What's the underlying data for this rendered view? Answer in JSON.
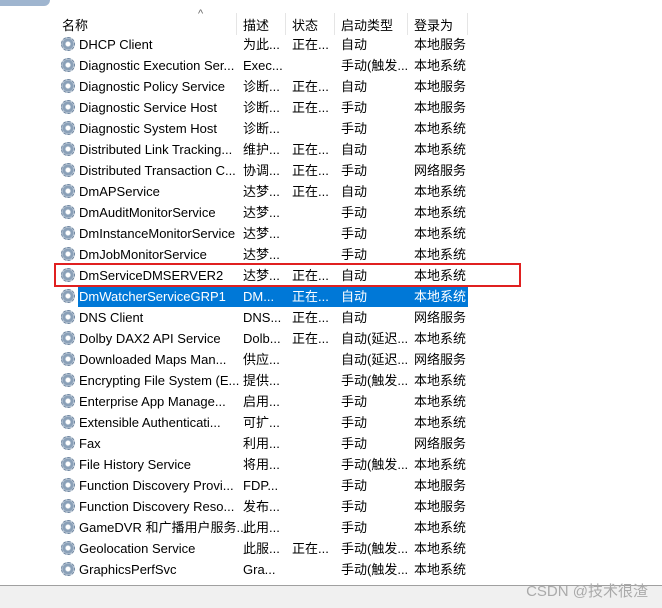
{
  "columns": [
    "名称",
    "描述",
    "状态",
    "启动类型",
    "登录为"
  ],
  "sort_indicator": "^",
  "selected_index": 12,
  "highlighted_index": 11,
  "rows": [
    {
      "name": "DHCP Client",
      "desc": "为此...",
      "status": "正在...",
      "startup": "自动",
      "logon": "本地服务"
    },
    {
      "name": "Diagnostic Execution Ser...",
      "desc": "Exec...",
      "status": "",
      "startup": "手动(触发...",
      "logon": "本地系统"
    },
    {
      "name": "Diagnostic Policy Service",
      "desc": "诊断...",
      "status": "正在...",
      "startup": "自动",
      "logon": "本地服务"
    },
    {
      "name": "Diagnostic Service Host",
      "desc": "诊断...",
      "status": "正在...",
      "startup": "手动",
      "logon": "本地服务"
    },
    {
      "name": "Diagnostic System Host",
      "desc": "诊断...",
      "status": "",
      "startup": "手动",
      "logon": "本地系统"
    },
    {
      "name": "Distributed Link Tracking...",
      "desc": "维护...",
      "status": "正在...",
      "startup": "自动",
      "logon": "本地系统"
    },
    {
      "name": "Distributed Transaction C...",
      "desc": "协调...",
      "status": "正在...",
      "startup": "手动",
      "logon": "网络服务"
    },
    {
      "name": "DmAPService",
      "desc": "达梦...",
      "status": "正在...",
      "startup": "自动",
      "logon": "本地系统"
    },
    {
      "name": "DmAuditMonitorService",
      "desc": "达梦...",
      "status": "",
      "startup": "手动",
      "logon": "本地系统"
    },
    {
      "name": "DmInstanceMonitorService",
      "desc": "达梦...",
      "status": "",
      "startup": "手动",
      "logon": "本地系统"
    },
    {
      "name": "DmJobMonitorService",
      "desc": "达梦...",
      "status": "",
      "startup": "手动",
      "logon": "本地系统"
    },
    {
      "name": "DmServiceDMSERVER2",
      "desc": "达梦...",
      "status": "正在...",
      "startup": "自动",
      "logon": "本地系统"
    },
    {
      "name": "DmWatcherServiceGRP1",
      "desc": "DM...",
      "status": "正在...",
      "startup": "自动",
      "logon": "本地系统"
    },
    {
      "name": "DNS Client",
      "desc": "DNS...",
      "status": "正在...",
      "startup": "自动",
      "logon": "网络服务"
    },
    {
      "name": "Dolby DAX2 API Service",
      "desc": "Dolb...",
      "status": "正在...",
      "startup": "自动(延迟...",
      "logon": "本地系统"
    },
    {
      "name": "Downloaded Maps Man...",
      "desc": "供应...",
      "status": "",
      "startup": "自动(延迟...",
      "logon": "网络服务"
    },
    {
      "name": "Encrypting File System (E...",
      "desc": "提供...",
      "status": "",
      "startup": "手动(触发...",
      "logon": "本地系统"
    },
    {
      "name": "Enterprise App Manage...",
      "desc": "启用...",
      "status": "",
      "startup": "手动",
      "logon": "本地系统"
    },
    {
      "name": "Extensible Authenticati...",
      "desc": "可扩...",
      "status": "",
      "startup": "手动",
      "logon": "本地系统"
    },
    {
      "name": "Fax",
      "desc": "利用...",
      "status": "",
      "startup": "手动",
      "logon": "网络服务"
    },
    {
      "name": "File History Service",
      "desc": "将用...",
      "status": "",
      "startup": "手动(触发...",
      "logon": "本地系统"
    },
    {
      "name": "Function Discovery Provi...",
      "desc": "FDP...",
      "status": "",
      "startup": "手动",
      "logon": "本地服务"
    },
    {
      "name": "Function Discovery Reso...",
      "desc": "发布...",
      "status": "",
      "startup": "手动",
      "logon": "本地服务"
    },
    {
      "name": "GameDVR 和广播用户服务...",
      "desc": "此用...",
      "status": "",
      "startup": "手动",
      "logon": "本地系统"
    },
    {
      "name": "Geolocation Service",
      "desc": "此服...",
      "status": "正在...",
      "startup": "手动(触发...",
      "logon": "本地系统"
    },
    {
      "name": "GraphicsPerfSvc",
      "desc": "Gra...",
      "status": "",
      "startup": "手动(触发...",
      "logon": "本地系统"
    }
  ],
  "watermark": "CSDN @技术很渣",
  "colors": {
    "selection": "#0078d7",
    "highlight_box": "#e02020"
  }
}
